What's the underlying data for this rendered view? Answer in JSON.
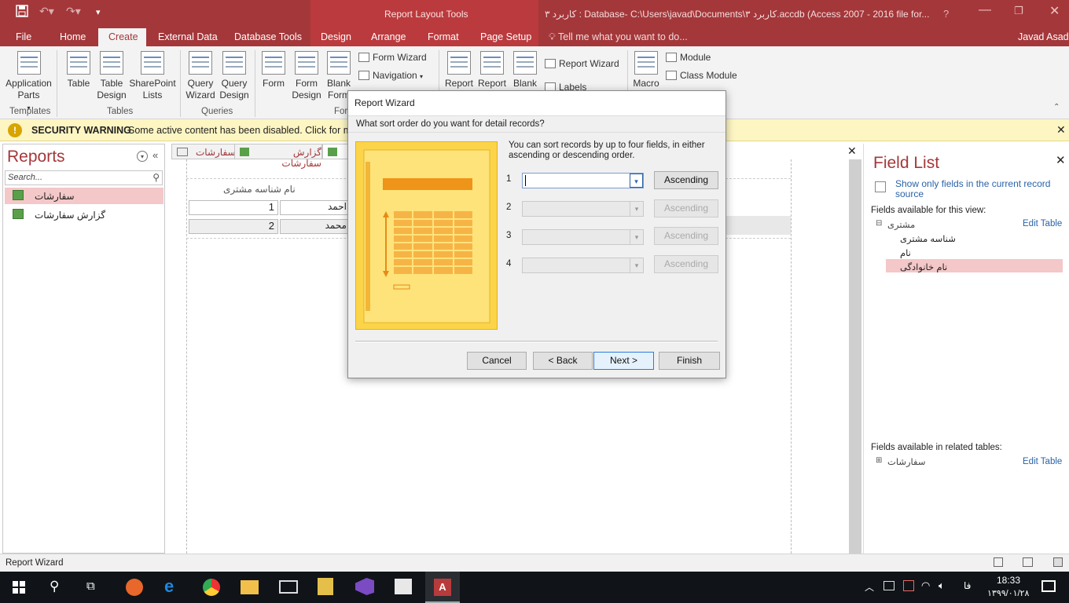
{
  "titlebar": {
    "context_tab": "Report Layout Tools",
    "title": "کاربرد ۳ : Database- C:\\Users\\javad\\Documents\\کاربرد ۳.accdb (Access 2007 - 2016 file for...",
    "help": "?",
    "user": "Javad Asadi"
  },
  "tabs": [
    "File",
    "Home",
    "Create",
    "External Data",
    "Database Tools",
    "Design",
    "Arrange",
    "Format",
    "Page Setup"
  ],
  "tell_me": "Tell me what you want to do...",
  "ribbon": {
    "app_parts": "Application Parts",
    "table": "Table",
    "table_design": "Table Design",
    "sharepoint_lists": "SharePoint Lists",
    "query_wizard": "Query Wizard",
    "query_design": "Query Design",
    "form": "Form",
    "form_design": "Form Design",
    "blank_form": "Blank Form",
    "form_wizard": "Form Wizard",
    "navigation": "Navigation",
    "report": "Report",
    "report_design": "Report",
    "blank_report": "Blank",
    "report_wizard": "Report Wizard",
    "labels": "Labels",
    "macro": "Macro",
    "module": "Module",
    "class_module": "Class Module",
    "groups": {
      "templates": "Templates",
      "tables": "Tables",
      "queries": "Queries",
      "forms": "For"
    }
  },
  "warning": {
    "title": "SECURITY WARNING",
    "text": "Some active content has been disabled. Click for mo"
  },
  "nav": {
    "title": "Reports",
    "search_placeholder": "Search...",
    "items": [
      "سفارشات",
      "گزارش سفارشات"
    ]
  },
  "doc": {
    "tabs": [
      "سفارشات",
      "گزارش سفارشات",
      ""
    ],
    "header_label": "نام شناسه مشتری",
    "rows": [
      {
        "id": "1",
        "name": "احمد"
      },
      {
        "id": "2",
        "name": "محمد"
      }
    ]
  },
  "fieldlist": {
    "title": "Field List",
    "show_only": "Show only fields in the current record source",
    "available_label": "Fields available for this view:",
    "table_name": "مشتری",
    "edit_table": "Edit Table",
    "fields": [
      "شناسه مشتری",
      "نام",
      "نام خانوادگی"
    ],
    "related_label": "Fields available in related tables:",
    "related_table": "سفارشات",
    "edit_table2": "Edit Table"
  },
  "status": {
    "text": "Report Wizard"
  },
  "taskbar": {
    "time": "18:33",
    "date": "۱۳۹۹/۰۱/۲۸",
    "lang": "فا"
  },
  "dialog": {
    "title": "Report Wizard",
    "question": "What sort order do you want for detail records?",
    "info": "You can sort records by up to four fields, in either ascending or descending order.",
    "rows": [
      {
        "num": "1",
        "value": "",
        "button": "Ascending"
      },
      {
        "num": "2",
        "value": "",
        "button": "Ascending"
      },
      {
        "num": "3",
        "value": "",
        "button": "Ascending"
      },
      {
        "num": "4",
        "value": "",
        "button": "Ascending"
      }
    ],
    "cancel": "Cancel",
    "back": "< Back",
    "next": "Next >",
    "finish": "Finish"
  },
  "colors": {
    "accent": "#a4373a",
    "warning_bg": "#fdf6c3",
    "selection": "#f4c7c9",
    "wizard_art": "#fbd44a"
  }
}
